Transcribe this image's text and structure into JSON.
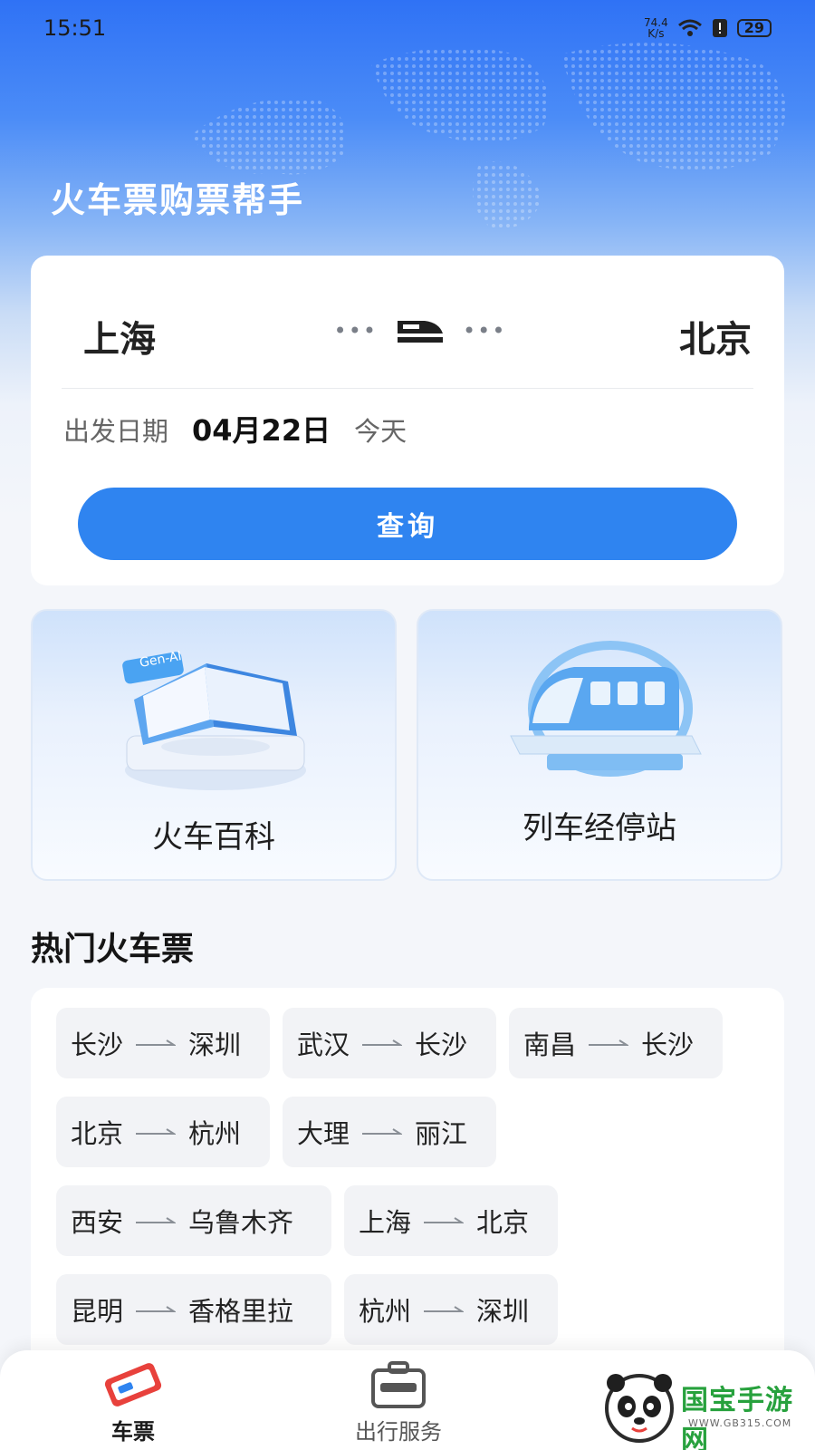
{
  "status_bar": {
    "time": "15:51",
    "net_speed_value": "74.4",
    "net_speed_unit": "K/s",
    "battery": "29"
  },
  "app": {
    "title": "火车票购票帮手"
  },
  "search": {
    "from_station": "上海",
    "to_station": "北京",
    "date_label": "出发日期",
    "date_value": "04月22日",
    "date_sub": "今天",
    "query_button": "查询"
  },
  "features": [
    {
      "label": "火车百科",
      "badge": "Gen-AI",
      "icon": "book-icon"
    },
    {
      "label": "列车经停站",
      "icon": "train-icon"
    }
  ],
  "hot_section": {
    "title": "热门火车票",
    "routes": [
      {
        "from": "长沙",
        "to": "深圳"
      },
      {
        "from": "武汉",
        "to": "长沙"
      },
      {
        "from": "南昌",
        "to": "长沙"
      },
      {
        "from": "北京",
        "to": "杭州"
      },
      {
        "from": "大理",
        "to": "丽江"
      },
      {
        "from": "西安",
        "to": "乌鲁木齐"
      },
      {
        "from": "上海",
        "to": "北京"
      },
      {
        "from": "昆明",
        "to": "香格里拉"
      },
      {
        "from": "杭州",
        "to": "深圳"
      }
    ]
  },
  "tab_bar": {
    "tabs": [
      {
        "label": "车票",
        "icon": "ticket-icon",
        "active": true
      },
      {
        "label": "出行服务",
        "icon": "briefcase-icon",
        "active": false
      }
    ]
  },
  "watermark": {
    "text": "国宝手游网",
    "url": "WWW.GB315.COM"
  },
  "colors": {
    "primary": "#2f84f0",
    "hero_top": "#2f72f5",
    "background": "#f4f6fa",
    "ticket_red": "#e8413c"
  }
}
